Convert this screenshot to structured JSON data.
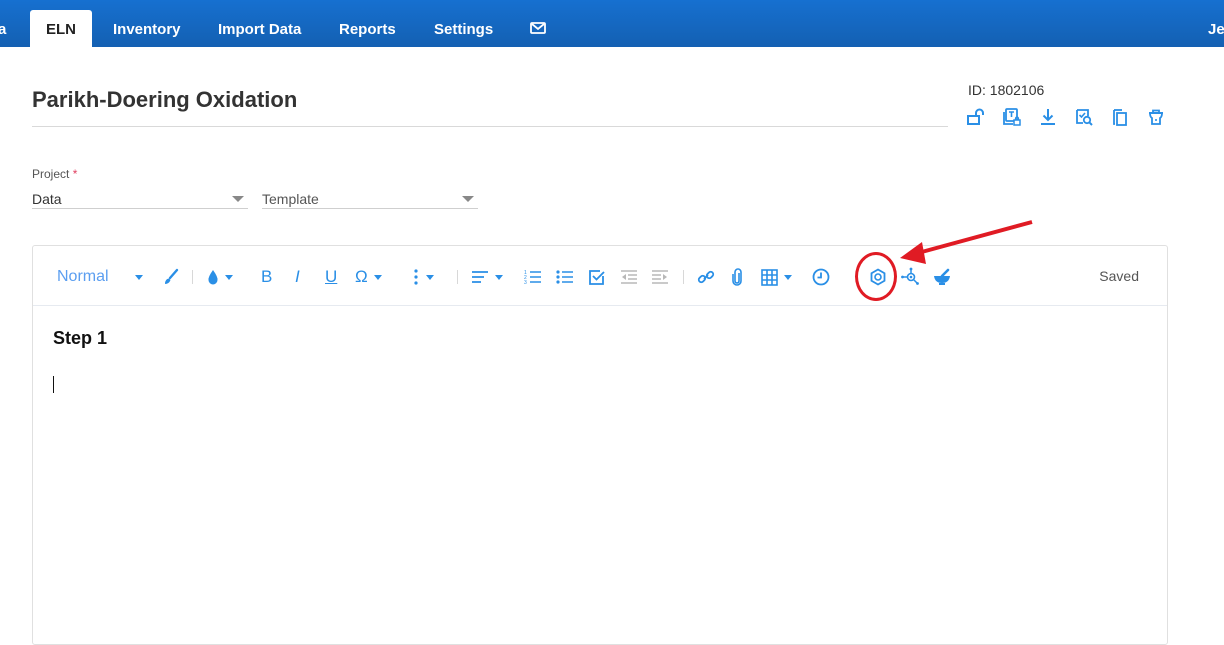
{
  "nav": {
    "partial_left": "a",
    "items": [
      {
        "label": "ELN",
        "active": true
      },
      {
        "label": "Inventory"
      },
      {
        "label": "Import Data"
      },
      {
        "label": "Reports"
      },
      {
        "label": "Settings"
      }
    ],
    "mail_icon": "envelope-icon",
    "user_partial": "Je"
  },
  "record": {
    "title": "Parikh-Doering Oxidation",
    "id_label": "ID: 1802106",
    "actions": [
      {
        "icon": "unlock-icon",
        "label": "Unlock"
      },
      {
        "icon": "template-lock-icon",
        "label": "Template"
      },
      {
        "icon": "download-icon",
        "label": "Download"
      },
      {
        "icon": "review-search-icon",
        "label": "Review"
      },
      {
        "icon": "copy-icon",
        "label": "Copy"
      },
      {
        "icon": "delete-icon",
        "label": "Delete"
      }
    ]
  },
  "form": {
    "project_label": "Project",
    "required_mark": "*",
    "project_value": "Data",
    "template_placeholder": "Template"
  },
  "editor": {
    "toolbar": {
      "format": "Normal",
      "bold": "B",
      "italic": "I",
      "underline": "U",
      "special_char": "Ω",
      "status": "Saved"
    },
    "content": {
      "heading": "Step 1"
    }
  },
  "colors": {
    "nav_bg": "#1565c0",
    "accent": "#2a8fe6",
    "annotation": "#e01b24"
  }
}
